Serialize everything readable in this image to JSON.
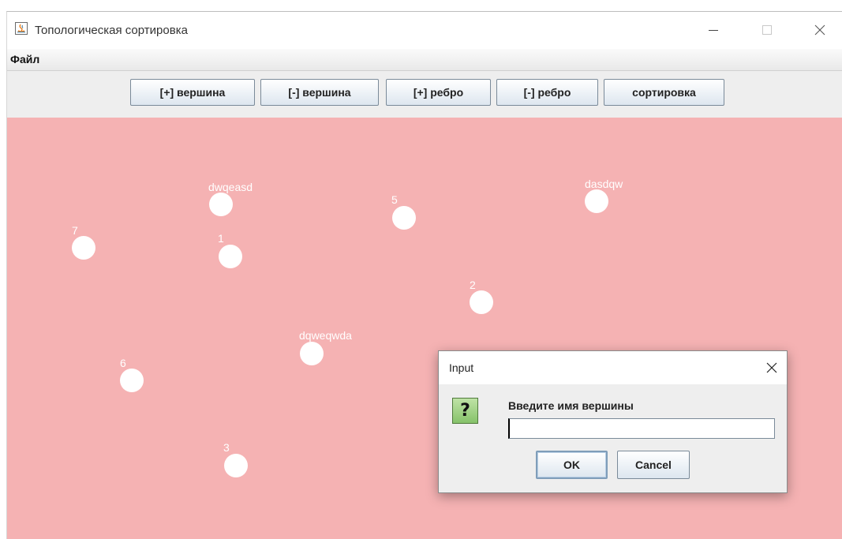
{
  "window": {
    "title": "Топологическая сортировка"
  },
  "menu": {
    "items": [
      "Файл"
    ]
  },
  "toolbar": {
    "add_vertex": "[+] вершина",
    "remove_vertex": "[-] вершина",
    "add_edge": "[+] ребро",
    "remove_edge": "[-] ребро",
    "sort": "сортировка"
  },
  "graph": {
    "background_color": "#f5b2b3",
    "node_color": "#ffffff",
    "nodes": [
      {
        "label": "dwqeasd"
      },
      {
        "label": "5"
      },
      {
        "label": "dasdqw"
      },
      {
        "label": "7"
      },
      {
        "label": "1"
      },
      {
        "label": "2"
      },
      {
        "label": "dqweqwda"
      },
      {
        "label": "6"
      },
      {
        "label": "3"
      }
    ]
  },
  "dialog": {
    "title": "Input",
    "prompt": "Введите имя вершины",
    "input_value": "",
    "icon": "question-icon",
    "ok_label": "OK",
    "cancel_label": "Cancel"
  }
}
